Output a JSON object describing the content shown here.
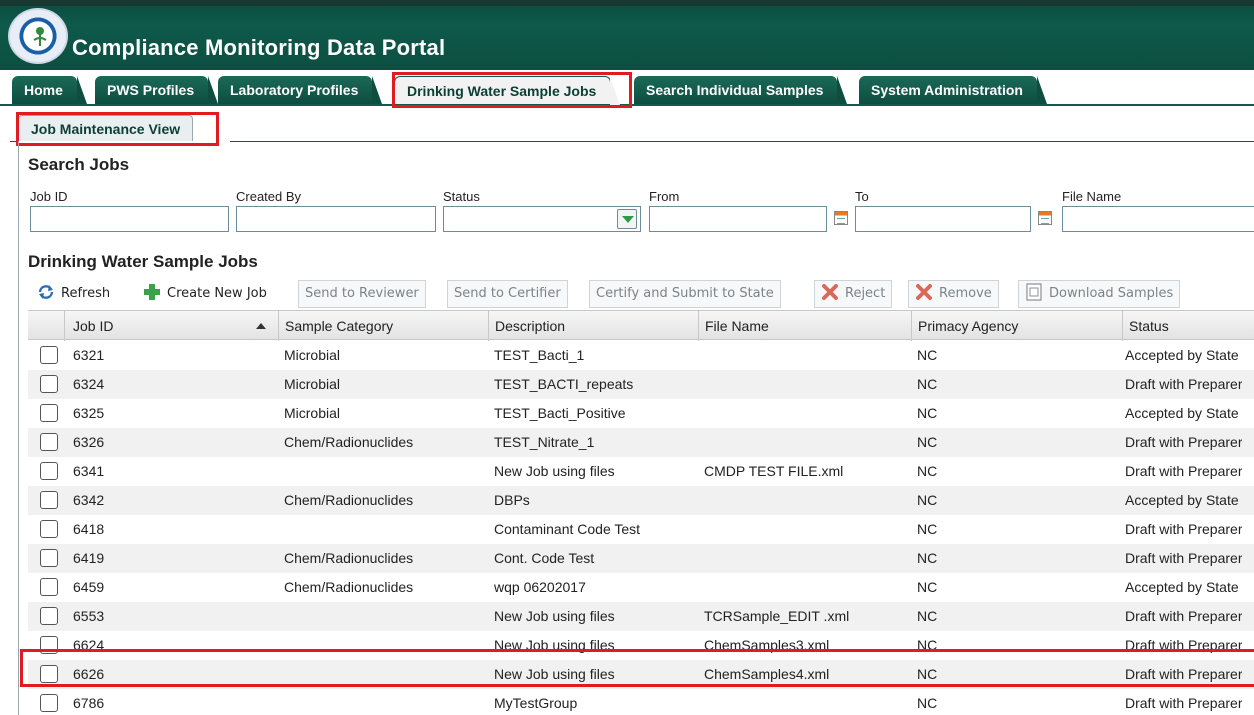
{
  "app": {
    "title": "Compliance Monitoring Data Portal"
  },
  "tabs": [
    {
      "label": "Home",
      "active": false
    },
    {
      "label": "PWS Profiles",
      "active": false
    },
    {
      "label": "Laboratory Profiles",
      "active": false
    },
    {
      "label": "Drinking Water Sample Jobs",
      "active": true
    },
    {
      "label": "Search Individual Samples",
      "active": false
    },
    {
      "label": "System Administration",
      "active": false
    }
  ],
  "subtab": {
    "label": "Job Maintenance View"
  },
  "search": {
    "title": "Search Jobs",
    "fields": {
      "job_id": {
        "label": "Job ID",
        "value": ""
      },
      "created_by": {
        "label": "Created By",
        "value": ""
      },
      "status": {
        "label": "Status",
        "value": ""
      },
      "from": {
        "label": "From",
        "value": ""
      },
      "to": {
        "label": "To",
        "value": ""
      },
      "file_name": {
        "label": "File Name",
        "value": ""
      }
    }
  },
  "jobs": {
    "title": "Drinking Water Sample Jobs",
    "toolbar": {
      "refresh": "Refresh",
      "create": "Create New Job",
      "send_reviewer": "Send to Reviewer",
      "send_certifier": "Send to Certifier",
      "certify": "Certify and Submit to State",
      "reject": "Reject",
      "remove": "Remove",
      "download": "Download Samples"
    },
    "columns": {
      "job_id": "Job ID",
      "category": "Sample Category",
      "description": "Description",
      "file_name": "File Name",
      "agency": "Primacy Agency",
      "status": "Status"
    },
    "sort": {
      "column": "Job ID",
      "direction": "ascending"
    },
    "rows": [
      {
        "id": "6321",
        "category": "Microbial",
        "description": "TEST_Bacti_1",
        "file": "",
        "agency": "NC",
        "status": "Accepted by State"
      },
      {
        "id": "6324",
        "category": "Microbial",
        "description": "TEST_BACTI_repeats",
        "file": "",
        "agency": "NC",
        "status": "Draft with Preparer"
      },
      {
        "id": "6325",
        "category": "Microbial",
        "description": "TEST_Bacti_Positive",
        "file": "",
        "agency": "NC",
        "status": "Accepted by State"
      },
      {
        "id": "6326",
        "category": "Chem/Radionuclides",
        "description": "TEST_Nitrate_1",
        "file": "",
        "agency": "NC",
        "status": "Draft with Preparer"
      },
      {
        "id": "6341",
        "category": "",
        "description": "New Job using files",
        "file": "CMDP TEST FILE.xml",
        "agency": "NC",
        "status": "Draft with Preparer"
      },
      {
        "id": "6342",
        "category": "Chem/Radionuclides",
        "description": "DBPs",
        "file": "",
        "agency": "NC",
        "status": "Accepted by State"
      },
      {
        "id": "6418",
        "category": "",
        "description": "Contaminant Code Test",
        "file": "",
        "agency": "NC",
        "status": "Draft with Preparer"
      },
      {
        "id": "6419",
        "category": "Chem/Radionuclides",
        "description": "Cont. Code Test",
        "file": "",
        "agency": "NC",
        "status": "Draft with Preparer"
      },
      {
        "id": "6459",
        "category": "Chem/Radionuclides",
        "description": "wqp 06202017",
        "file": "",
        "agency": "NC",
        "status": "Accepted by State"
      },
      {
        "id": "6553",
        "category": "",
        "description": "New Job using files",
        "file": "TCRSample_EDIT .xml",
        "agency": "NC",
        "status": "Draft with Preparer"
      },
      {
        "id": "6624",
        "category": "",
        "description": "New Job using files",
        "file": "ChemSamples3.xml",
        "agency": "NC",
        "status": "Draft with Preparer"
      },
      {
        "id": "6626",
        "category": "",
        "description": "New Job using files",
        "file": "ChemSamples4.xml",
        "agency": "NC",
        "status": "Draft with Preparer"
      },
      {
        "id": "6786",
        "category": "",
        "description": "MyTestGroup",
        "file": "",
        "agency": "NC",
        "status": "Draft with Preparer"
      }
    ]
  },
  "colors": {
    "brand": "#0e5a4b",
    "highlight": "#e11b22"
  }
}
